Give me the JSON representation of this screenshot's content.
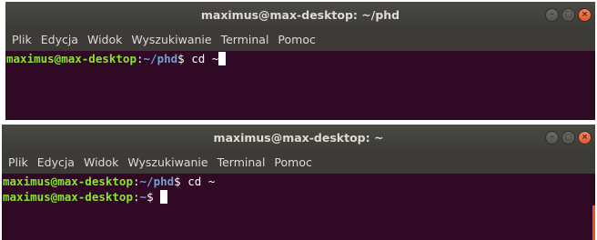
{
  "window1": {
    "title": "maximus@max-desktop: ~/phd",
    "menu": [
      "Plik",
      "Edycja",
      "Widok",
      "Wyszukiwanie",
      "Terminal",
      "Pomoc"
    ],
    "lines": [
      {
        "user": "maximus@max-desktop",
        "sep": ":",
        "path": "~/phd",
        "prompt": "$ ",
        "command": "cd ~",
        "cursor": true
      }
    ]
  },
  "window2": {
    "title": "maximus@max-desktop: ~",
    "menu": [
      "Plik",
      "Edycja",
      "Widok",
      "Wyszukiwanie",
      "Terminal",
      "Pomoc"
    ],
    "lines": [
      {
        "user": "maximus@max-desktop",
        "sep": ":",
        "path": "~/phd",
        "prompt": "$ ",
        "command": "cd ~",
        "cursor": false
      },
      {
        "user": "maximus@max-desktop",
        "sep": ":",
        "path": "~",
        "prompt": "$ ",
        "command": "",
        "cursor": true
      }
    ]
  },
  "wm_buttons": {
    "minimize": "–",
    "maximize": "□",
    "close": "×"
  },
  "colors": {
    "terminal_bg": "#300a24",
    "titlebar": "#3c3b37",
    "user_green": "#8ae234",
    "path_blue": "#729fcf",
    "close_orange": "#e95420"
  }
}
